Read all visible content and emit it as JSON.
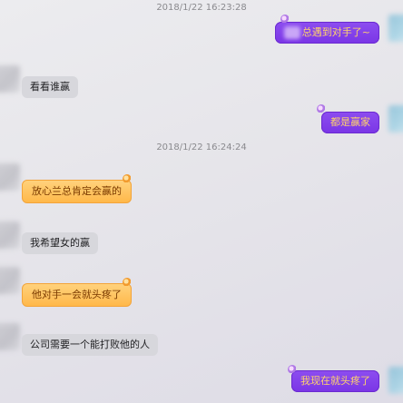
{
  "chat": {
    "timestamp_1": "2018/1/22 16:23:28",
    "timestamp_2": "2018/1/22 16:24:24",
    "messages": [
      {
        "text": "总遇到对手了~"
      },
      {
        "text": "看看谁赢"
      },
      {
        "text": "都是赢家"
      },
      {
        "text": "放心兰总肯定会赢的"
      },
      {
        "text": "我希望女的赢"
      },
      {
        "text": "他对手一会就头疼了"
      },
      {
        "text": "公司需要一个能打败他的人"
      },
      {
        "text": "我现在就头疼了"
      }
    ]
  },
  "colors": {
    "self_bubble": "#7a35e6",
    "self_text": "#ffd36b",
    "other_bubble": "#d7d7dc",
    "vip_bubble": "#ffb84a"
  }
}
